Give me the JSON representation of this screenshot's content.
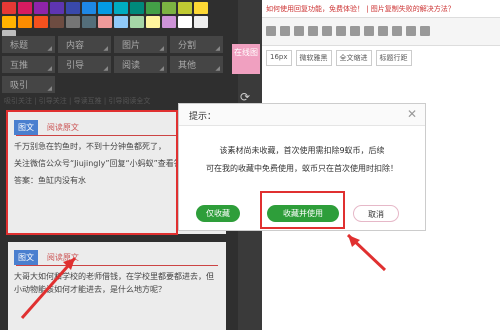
{
  "swatches": [
    "#e53935",
    "#d81b60",
    "#8e24aa",
    "#5e35b1",
    "#3949ab",
    "#1e88e5",
    "#039be5",
    "#00acc1",
    "#00897b",
    "#43a047",
    "#7cb342",
    "#c0ca33",
    "#fdd835",
    "#ffb300",
    "#fb8c00",
    "#f4511e",
    "#6d4c41",
    "#757575",
    "#546e7a",
    "#ef9a9a",
    "#90caf9",
    "#a5d6a7",
    "#fff59d",
    "#ce93d8",
    "#ffffff",
    "#eeeeee",
    "#bdbdbd"
  ],
  "categories": [
    "标题",
    "内容",
    "图片",
    "分割",
    "互推",
    "引导",
    "阅读",
    "其他",
    "吸引"
  ],
  "subnav": "吸引关注 | 引导关注 | 导读互推 | 引导阅读全文",
  "card1": {
    "tag": "图文",
    "title": "阅读原文",
    "lines": [
      "千万别急在钓鱼时，不到十分钟鱼都死了，",
      "关注微信公众号“Jiujingly”回复“小蚂蚁”查看答案",
      "答案：鱼缸内没有水"
    ]
  },
  "card2": {
    "tag": "图文",
    "title": "阅读原文",
    "lines": [
      "大哥大如何和学校的老师借钱，在学校里都要都进去，但小动物能该如何才能进去，是什么地方呢？"
    ]
  },
  "midbtn": "在线图",
  "right": {
    "topbar": "如何使用回复功能，免费体验！ | 图片复制失败的解决方法？",
    "selects": [
      "16px",
      "微软雅黑",
      "全文缩进",
      "标题行距"
    ]
  },
  "modal": {
    "title": "提示：",
    "line1": "该素材尚未收藏，首次使用需扣除9蚁币，后续",
    "line2": "可在我的收藏中免费使用，蚁币只在首次使用时扣除！",
    "btn_collect": "仅收藏",
    "btn_use": "收藏并使用",
    "btn_cancel": "取消"
  }
}
